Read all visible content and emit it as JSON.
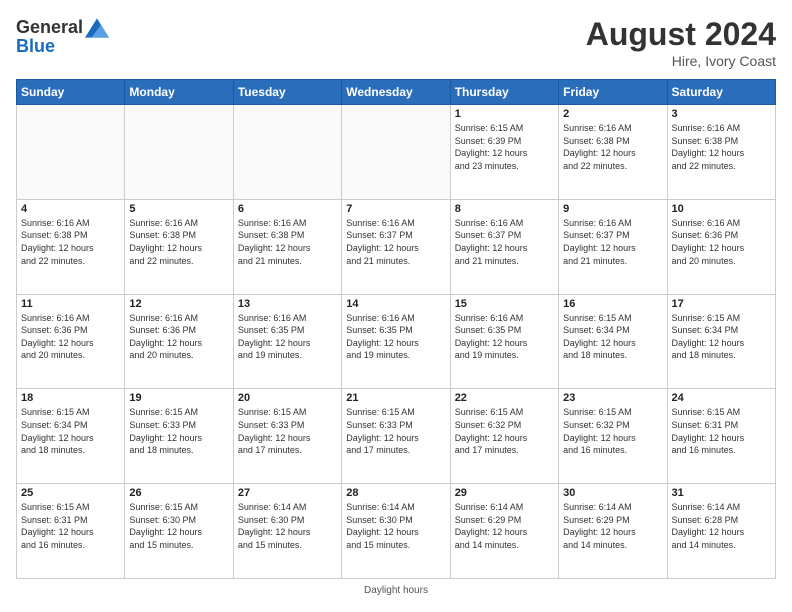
{
  "header": {
    "logo_line1": "General",
    "logo_line2": "Blue",
    "month_year": "August 2024",
    "location": "Hire, Ivory Coast"
  },
  "days_of_week": [
    "Sunday",
    "Monday",
    "Tuesday",
    "Wednesday",
    "Thursday",
    "Friday",
    "Saturday"
  ],
  "weeks": [
    [
      {
        "day": "",
        "info": ""
      },
      {
        "day": "",
        "info": ""
      },
      {
        "day": "",
        "info": ""
      },
      {
        "day": "",
        "info": ""
      },
      {
        "day": "1",
        "info": "Sunrise: 6:15 AM\nSunset: 6:39 PM\nDaylight: 12 hours\nand 23 minutes."
      },
      {
        "day": "2",
        "info": "Sunrise: 6:16 AM\nSunset: 6:38 PM\nDaylight: 12 hours\nand 22 minutes."
      },
      {
        "day": "3",
        "info": "Sunrise: 6:16 AM\nSunset: 6:38 PM\nDaylight: 12 hours\nand 22 minutes."
      }
    ],
    [
      {
        "day": "4",
        "info": "Sunrise: 6:16 AM\nSunset: 6:38 PM\nDaylight: 12 hours\nand 22 minutes."
      },
      {
        "day": "5",
        "info": "Sunrise: 6:16 AM\nSunset: 6:38 PM\nDaylight: 12 hours\nand 22 minutes."
      },
      {
        "day": "6",
        "info": "Sunrise: 6:16 AM\nSunset: 6:38 PM\nDaylight: 12 hours\nand 21 minutes."
      },
      {
        "day": "7",
        "info": "Sunrise: 6:16 AM\nSunset: 6:37 PM\nDaylight: 12 hours\nand 21 minutes."
      },
      {
        "day": "8",
        "info": "Sunrise: 6:16 AM\nSunset: 6:37 PM\nDaylight: 12 hours\nand 21 minutes."
      },
      {
        "day": "9",
        "info": "Sunrise: 6:16 AM\nSunset: 6:37 PM\nDaylight: 12 hours\nand 21 minutes."
      },
      {
        "day": "10",
        "info": "Sunrise: 6:16 AM\nSunset: 6:36 PM\nDaylight: 12 hours\nand 20 minutes."
      }
    ],
    [
      {
        "day": "11",
        "info": "Sunrise: 6:16 AM\nSunset: 6:36 PM\nDaylight: 12 hours\nand 20 minutes."
      },
      {
        "day": "12",
        "info": "Sunrise: 6:16 AM\nSunset: 6:36 PM\nDaylight: 12 hours\nand 20 minutes."
      },
      {
        "day": "13",
        "info": "Sunrise: 6:16 AM\nSunset: 6:35 PM\nDaylight: 12 hours\nand 19 minutes."
      },
      {
        "day": "14",
        "info": "Sunrise: 6:16 AM\nSunset: 6:35 PM\nDaylight: 12 hours\nand 19 minutes."
      },
      {
        "day": "15",
        "info": "Sunrise: 6:16 AM\nSunset: 6:35 PM\nDaylight: 12 hours\nand 19 minutes."
      },
      {
        "day": "16",
        "info": "Sunrise: 6:15 AM\nSunset: 6:34 PM\nDaylight: 12 hours\nand 18 minutes."
      },
      {
        "day": "17",
        "info": "Sunrise: 6:15 AM\nSunset: 6:34 PM\nDaylight: 12 hours\nand 18 minutes."
      }
    ],
    [
      {
        "day": "18",
        "info": "Sunrise: 6:15 AM\nSunset: 6:34 PM\nDaylight: 12 hours\nand 18 minutes."
      },
      {
        "day": "19",
        "info": "Sunrise: 6:15 AM\nSunset: 6:33 PM\nDaylight: 12 hours\nand 18 minutes."
      },
      {
        "day": "20",
        "info": "Sunrise: 6:15 AM\nSunset: 6:33 PM\nDaylight: 12 hours\nand 17 minutes."
      },
      {
        "day": "21",
        "info": "Sunrise: 6:15 AM\nSunset: 6:33 PM\nDaylight: 12 hours\nand 17 minutes."
      },
      {
        "day": "22",
        "info": "Sunrise: 6:15 AM\nSunset: 6:32 PM\nDaylight: 12 hours\nand 17 minutes."
      },
      {
        "day": "23",
        "info": "Sunrise: 6:15 AM\nSunset: 6:32 PM\nDaylight: 12 hours\nand 16 minutes."
      },
      {
        "day": "24",
        "info": "Sunrise: 6:15 AM\nSunset: 6:31 PM\nDaylight: 12 hours\nand 16 minutes."
      }
    ],
    [
      {
        "day": "25",
        "info": "Sunrise: 6:15 AM\nSunset: 6:31 PM\nDaylight: 12 hours\nand 16 minutes."
      },
      {
        "day": "26",
        "info": "Sunrise: 6:15 AM\nSunset: 6:30 PM\nDaylight: 12 hours\nand 15 minutes."
      },
      {
        "day": "27",
        "info": "Sunrise: 6:14 AM\nSunset: 6:30 PM\nDaylight: 12 hours\nand 15 minutes."
      },
      {
        "day": "28",
        "info": "Sunrise: 6:14 AM\nSunset: 6:30 PM\nDaylight: 12 hours\nand 15 minutes."
      },
      {
        "day": "29",
        "info": "Sunrise: 6:14 AM\nSunset: 6:29 PM\nDaylight: 12 hours\nand 14 minutes."
      },
      {
        "day": "30",
        "info": "Sunrise: 6:14 AM\nSunset: 6:29 PM\nDaylight: 12 hours\nand 14 minutes."
      },
      {
        "day": "31",
        "info": "Sunrise: 6:14 AM\nSunset: 6:28 PM\nDaylight: 12 hours\nand 14 minutes."
      }
    ]
  ],
  "footer": {
    "daylight_label": "Daylight hours"
  }
}
